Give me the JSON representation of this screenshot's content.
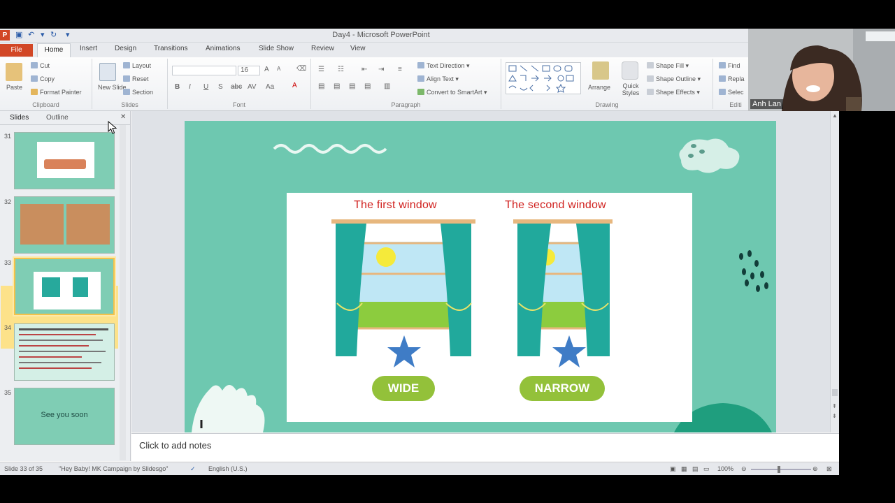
{
  "app": {
    "title": "Day4 - Microsoft PowerPoint",
    "icon_letter": "P"
  },
  "tabs": [
    {
      "label": "File"
    },
    {
      "label": "Home"
    },
    {
      "label": "Insert"
    },
    {
      "label": "Design"
    },
    {
      "label": "Transitions"
    },
    {
      "label": "Animations"
    },
    {
      "label": "Slide Show"
    },
    {
      "label": "Review"
    },
    {
      "label": "View"
    }
  ],
  "ribbon": {
    "clipboard": {
      "paste": "Paste",
      "cut": "Cut",
      "copy": "Copy",
      "format_painter": "Format Painter",
      "label": "Clipboard"
    },
    "slides": {
      "new_slide": "New Slide",
      "layout": "Layout",
      "reset": "Reset",
      "section": "Section",
      "label": "Slides"
    },
    "font": {
      "label": "Font",
      "size": "16",
      "bold": "B",
      "italic": "I",
      "underline": "U",
      "strike": "S",
      "abc": "abc",
      "spacing": "AV",
      "case": "Aa",
      "grow": "A",
      "shrink": "A",
      "color": "A"
    },
    "paragraph": {
      "label": "Paragraph",
      "text_direction": "Text Direction",
      "align_text": "Align Text",
      "convert_smartart": "Convert to SmartArt"
    },
    "drawing": {
      "label": "Drawing",
      "arrange": "Arrange",
      "quick_styles": "Quick Styles",
      "shape_fill": "Shape Fill",
      "shape_outline": "Shape Outline",
      "shape_effects": "Shape Effects"
    },
    "editing": {
      "find": "Find",
      "replace": "Repla",
      "select": "Selec",
      "label": "Editi"
    }
  },
  "left_pane": {
    "tabs": [
      "Slides",
      "Outline"
    ],
    "slides": [
      {
        "number": "31"
      },
      {
        "number": "32"
      },
      {
        "number": "33"
      },
      {
        "number": "34"
      },
      {
        "number": "35",
        "text": "See you soon"
      }
    ]
  },
  "slide": {
    "left_title": "The first window",
    "right_title": "The second window",
    "left_label": "WIDE",
    "right_label": "NARROW"
  },
  "notes": {
    "placeholder": "Click to add notes"
  },
  "status": {
    "slide_info": "Slide 33 of 35",
    "theme": "\"Hey Baby! MK Campaign by Slidesgo\"",
    "language": "English (U.S.)",
    "zoom": "100%"
  },
  "webcam": {
    "name": "Anh Lan"
  },
  "colors": {
    "accent": "#d24726",
    "slide_bg": "#6ec8b0",
    "pill": "#93c13a",
    "title_red": "#d0201e",
    "curtain": "#21a99c"
  }
}
